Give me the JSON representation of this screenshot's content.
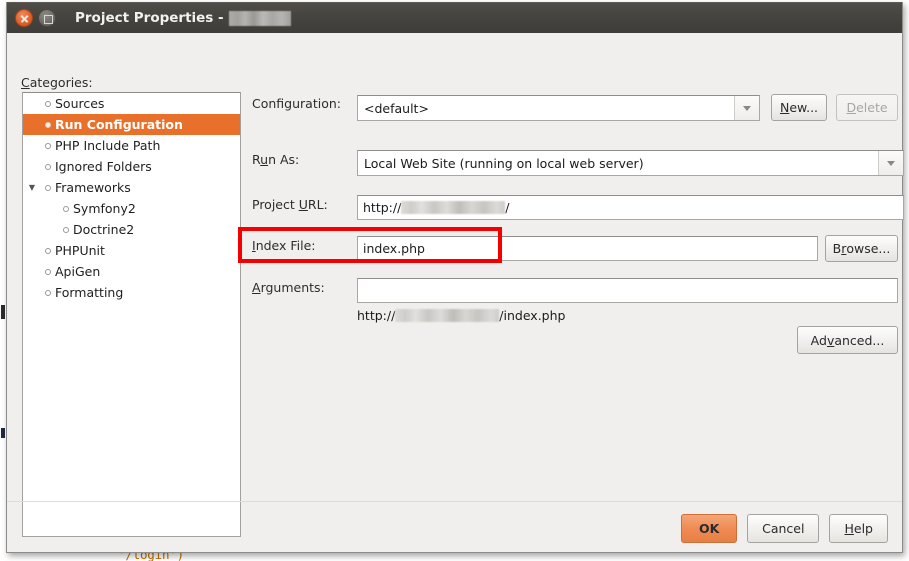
{
  "window": {
    "title_prefix": "Project Properties - ",
    "title_redacted": true,
    "close_icon": "close-icon",
    "maximize_icon": "maximize-icon"
  },
  "categories": {
    "label": "Categories:",
    "label_mnemonic": "C",
    "items": [
      {
        "label": "Sources",
        "selected": false,
        "indent": false,
        "expandable": false
      },
      {
        "label": "Run Configuration",
        "selected": true,
        "indent": false,
        "expandable": false
      },
      {
        "label": "PHP Include Path",
        "selected": false,
        "indent": false,
        "expandable": false
      },
      {
        "label": "Ignored Folders",
        "selected": false,
        "indent": false,
        "expandable": false
      },
      {
        "label": "Frameworks",
        "selected": false,
        "indent": false,
        "expandable": true,
        "expanded": true
      },
      {
        "label": "Symfony2",
        "selected": false,
        "indent": true,
        "expandable": false
      },
      {
        "label": "Doctrine2",
        "selected": false,
        "indent": true,
        "expandable": false
      },
      {
        "label": "PHPUnit",
        "selected": false,
        "indent": false,
        "expandable": false
      },
      {
        "label": "ApiGen",
        "selected": false,
        "indent": false,
        "expandable": false
      },
      {
        "label": "Formatting",
        "selected": false,
        "indent": false,
        "expandable": false
      }
    ]
  },
  "form": {
    "configuration": {
      "label": "Configuration:",
      "value": "<default>",
      "arrow_icon": "chevron-down-icon"
    },
    "new_button": {
      "label_pre": "N",
      "label_post": "ew...",
      "mnemonic": "N",
      "disabled": false
    },
    "delete_button": {
      "label_pre": "D",
      "label_post": "elete",
      "mnemonic": "D",
      "disabled": true
    },
    "run_as": {
      "label_pre": "R",
      "label_mn": "u",
      "label_post": "n As:",
      "value": "Local Web Site (running on local web server)",
      "arrow_icon": "chevron-down-icon"
    },
    "project_url": {
      "label_pre": "Project ",
      "label_mn": "U",
      "label_post": "RL:",
      "value_prefix": "http://",
      "value_redacted": true,
      "value_suffix": "/"
    },
    "index_file": {
      "label_mn": "I",
      "label_post": "ndex File:",
      "value": "index.php",
      "highlighted": true
    },
    "browse_button": {
      "label_pre": "B",
      "label_mn": "r",
      "label_post": "owse...",
      "disabled": false
    },
    "arguments": {
      "label_mn": "A",
      "label_post": "rguments:",
      "value": ""
    },
    "result_url": {
      "prefix": "http://",
      "redacted": true,
      "suffix": "/index.php"
    },
    "advanced_button": {
      "label_pre": "Ad",
      "label_mn": "v",
      "label_post": "anced...",
      "disabled": false
    }
  },
  "footer": {
    "ok": {
      "label": "OK",
      "default": true
    },
    "cancel": {
      "label": "Cancel",
      "default": false
    },
    "help": {
      "label_mn": "H",
      "label_post": "elp",
      "default": false
    }
  },
  "background": {
    "code_fragment": "'/login')",
    "code_paren": ")"
  },
  "colors": {
    "titlebar": "#46443f",
    "dialog_bg": "#f0efed",
    "selection": "#e8702a",
    "default_button": "#ef8b53",
    "annotation": "#f40000",
    "field_bg": "#ffffff"
  }
}
